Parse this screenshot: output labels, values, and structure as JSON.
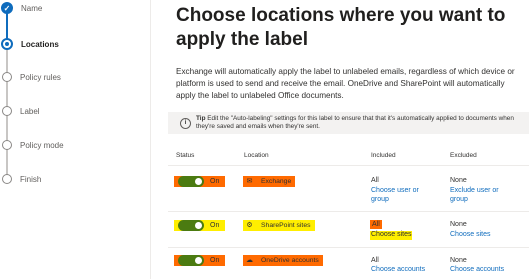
{
  "wizard": {
    "steps": [
      {
        "label": "Name",
        "state": "done"
      },
      {
        "label": "Locations",
        "state": "current"
      },
      {
        "label": "Policy rules",
        "state": "pending"
      },
      {
        "label": "Label",
        "state": "pending"
      },
      {
        "label": "Policy mode",
        "state": "pending"
      },
      {
        "label": "Finish",
        "state": "pending"
      }
    ]
  },
  "main": {
    "title": "Choose locations where you want to apply the label",
    "description": "Exchange will automatically apply the label to unlabeled emails, regardless of which device or platform is used to send and receive the email. OneDrive and SharePoint will automatically apply the label to unlabeled Office documents.",
    "tip_prefix": "Tip",
    "tip_text": "Edit the \"Auto-labeling\" settings for this label to ensure that that it's automatically applied to documents when they're saved and emails when they're sent."
  },
  "table": {
    "headers": {
      "status": "Status",
      "location": "Location",
      "included": "Included",
      "excluded": "Excluded"
    },
    "rows": [
      {
        "status": "On",
        "location": "Exchange",
        "included": "All",
        "include_link": "Choose user or group",
        "excluded": "None",
        "exclude_link": "Exclude user or group"
      },
      {
        "status": "On",
        "location": "SharePoint sites",
        "included": "All",
        "include_link": "Choose sites",
        "excluded": "None",
        "exclude_link": "Choose sites"
      },
      {
        "status": "On",
        "location": "OneDrive accounts",
        "included": "All",
        "include_link": "Choose accounts",
        "excluded": "None",
        "exclude_link": "Choose accounts"
      }
    ]
  },
  "colors": {
    "accent": "#0f6cbd",
    "toggle_on": "#4b7b11",
    "highlight_orange": "#ff6a00",
    "highlight_yellow": "#ffee00"
  }
}
